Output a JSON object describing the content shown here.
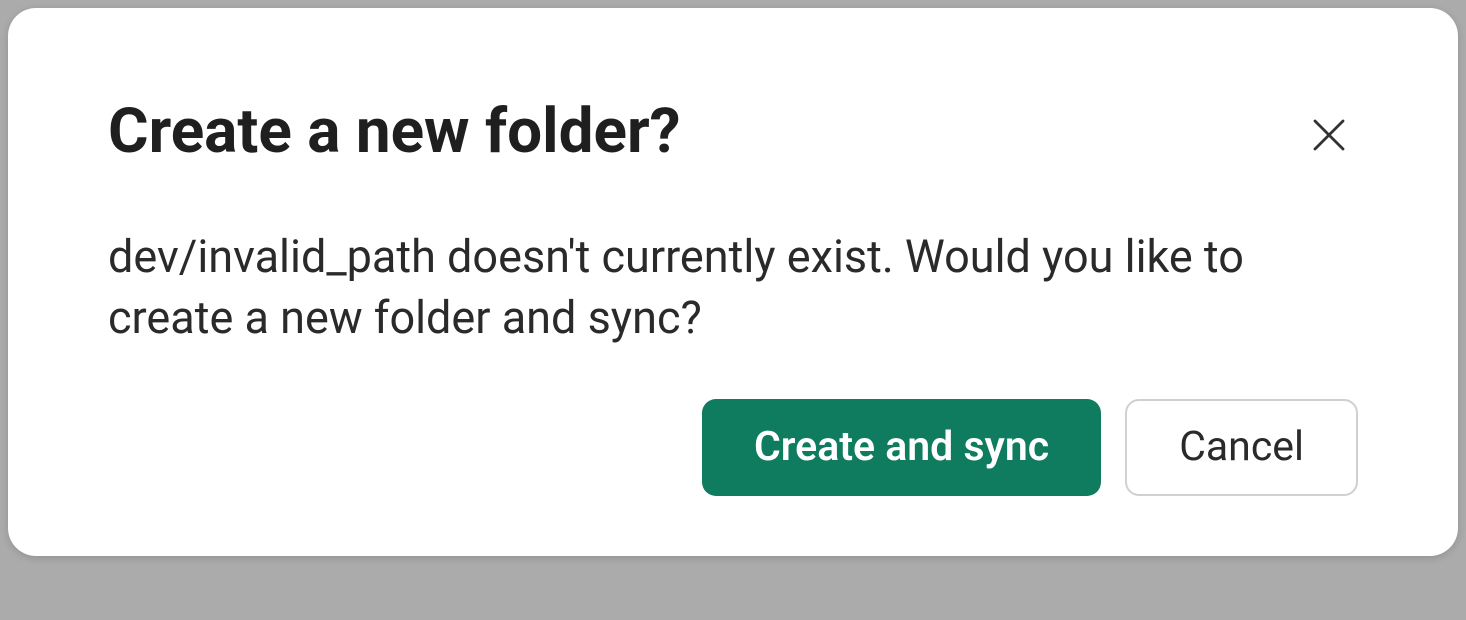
{
  "dialog": {
    "title": "Create a new folder?",
    "message": "dev/invalid_path doesn't currently exist. Would you like to create a new folder and sync?",
    "buttons": {
      "primary": "Create and sync",
      "secondary": "Cancel"
    }
  }
}
